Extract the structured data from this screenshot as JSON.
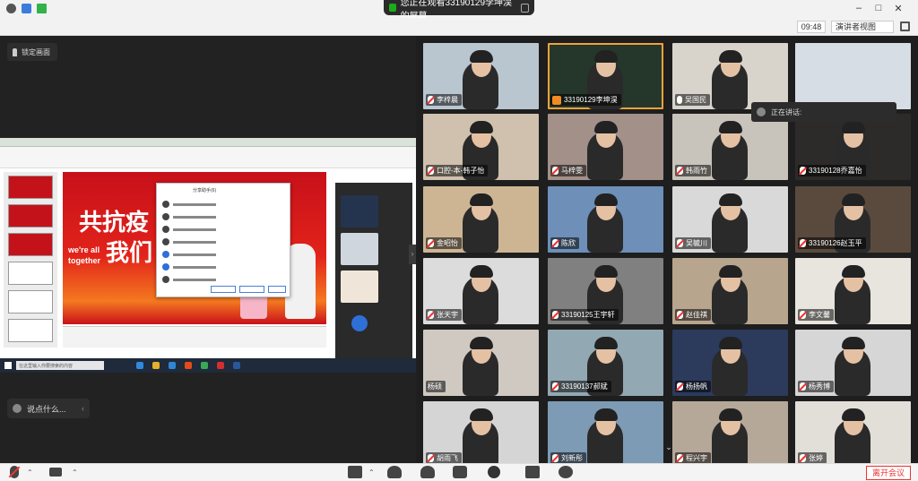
{
  "window": {
    "share_banner": "您正在观看33190129李坤淏的屏幕",
    "time": "09:48",
    "view_mode": "演讲者视图",
    "minimize": "–",
    "maximize": "□",
    "close": "✕"
  },
  "left": {
    "pin_label": "锁定画面",
    "chat_placeholder": "说点什么...",
    "chat_arrow": "‹",
    "collapse_arrow": "›",
    "slide": {
      "line1": "共抗疫",
      "line2": "我们",
      "en1": "we're all",
      "en2": "together"
    },
    "dialog_title": "分享助手(6)",
    "taskbar_search": "在这里输入你要搜索的内容"
  },
  "speaking": {
    "label": "正在讲话:"
  },
  "tiles": [
    {
      "name": "李梓晨",
      "mic": "muted",
      "bg": "#b9c6d0"
    },
    {
      "name": "33190129李坤淏",
      "mic": "host",
      "bg": "#25372b",
      "active": true
    },
    {
      "name": "吴国民",
      "mic": "on",
      "bg": "#d8d4cc"
    },
    {
      "name": "",
      "mic": "none",
      "bg": "#d7dde4"
    },
    {
      "name": "口腔-本-韩子怡",
      "mic": "muted",
      "bg": "#cfc1ad"
    },
    {
      "name": "马梓雯",
      "mic": "muted",
      "bg": "#a29089"
    },
    {
      "name": "韩雨竹",
      "mic": "muted",
      "bg": "#c9c4bb"
    },
    {
      "name": "33190128乔嘉怡",
      "mic": "muted",
      "bg": "#2c2b29"
    },
    {
      "name": "金昭怡",
      "mic": "muted",
      "bg": "#cdb594"
    },
    {
      "name": "陈欣",
      "mic": "muted",
      "bg": "#6d8fb8"
    },
    {
      "name": "吴毓川",
      "mic": "muted",
      "bg": "#d9d9d9"
    },
    {
      "name": "33190126赵玉平",
      "mic": "muted",
      "bg": "#5a4a3e"
    },
    {
      "name": "张天宇",
      "mic": "muted",
      "bg": "#dcdcdc"
    },
    {
      "name": "33190125王宇轩",
      "mic": "muted",
      "bg": "#808080"
    },
    {
      "name": "赵佳祺",
      "mic": "muted",
      "bg": "#b7a58e"
    },
    {
      "name": "李文馨",
      "mic": "muted",
      "bg": "#e8e4de"
    },
    {
      "name": "杨硕",
      "mic": "none",
      "bg": "#cfc9c1"
    },
    {
      "name": "33190137郝斌",
      "mic": "muted",
      "bg": "#92a8b3"
    },
    {
      "name": "杨扬帆",
      "mic": "muted",
      "bg": "#2c3a5c"
    },
    {
      "name": "杨秀博",
      "mic": "muted",
      "bg": "#d6d6d6"
    },
    {
      "name": "胡雨飞",
      "mic": "muted",
      "bg": "#d5d5d5"
    },
    {
      "name": "刘新彤",
      "mic": "muted",
      "bg": "#7d9bb5"
    },
    {
      "name": "程兴宇",
      "mic": "muted",
      "bg": "#b6a899"
    },
    {
      "name": "张婷",
      "mic": "muted",
      "bg": "#e2dfd9"
    }
  ],
  "bottom": {
    "end_meeting": "离开会议"
  },
  "colors": {
    "accent": "#f0a33a",
    "danger": "#e33333",
    "slide_red": "#c8101a"
  }
}
